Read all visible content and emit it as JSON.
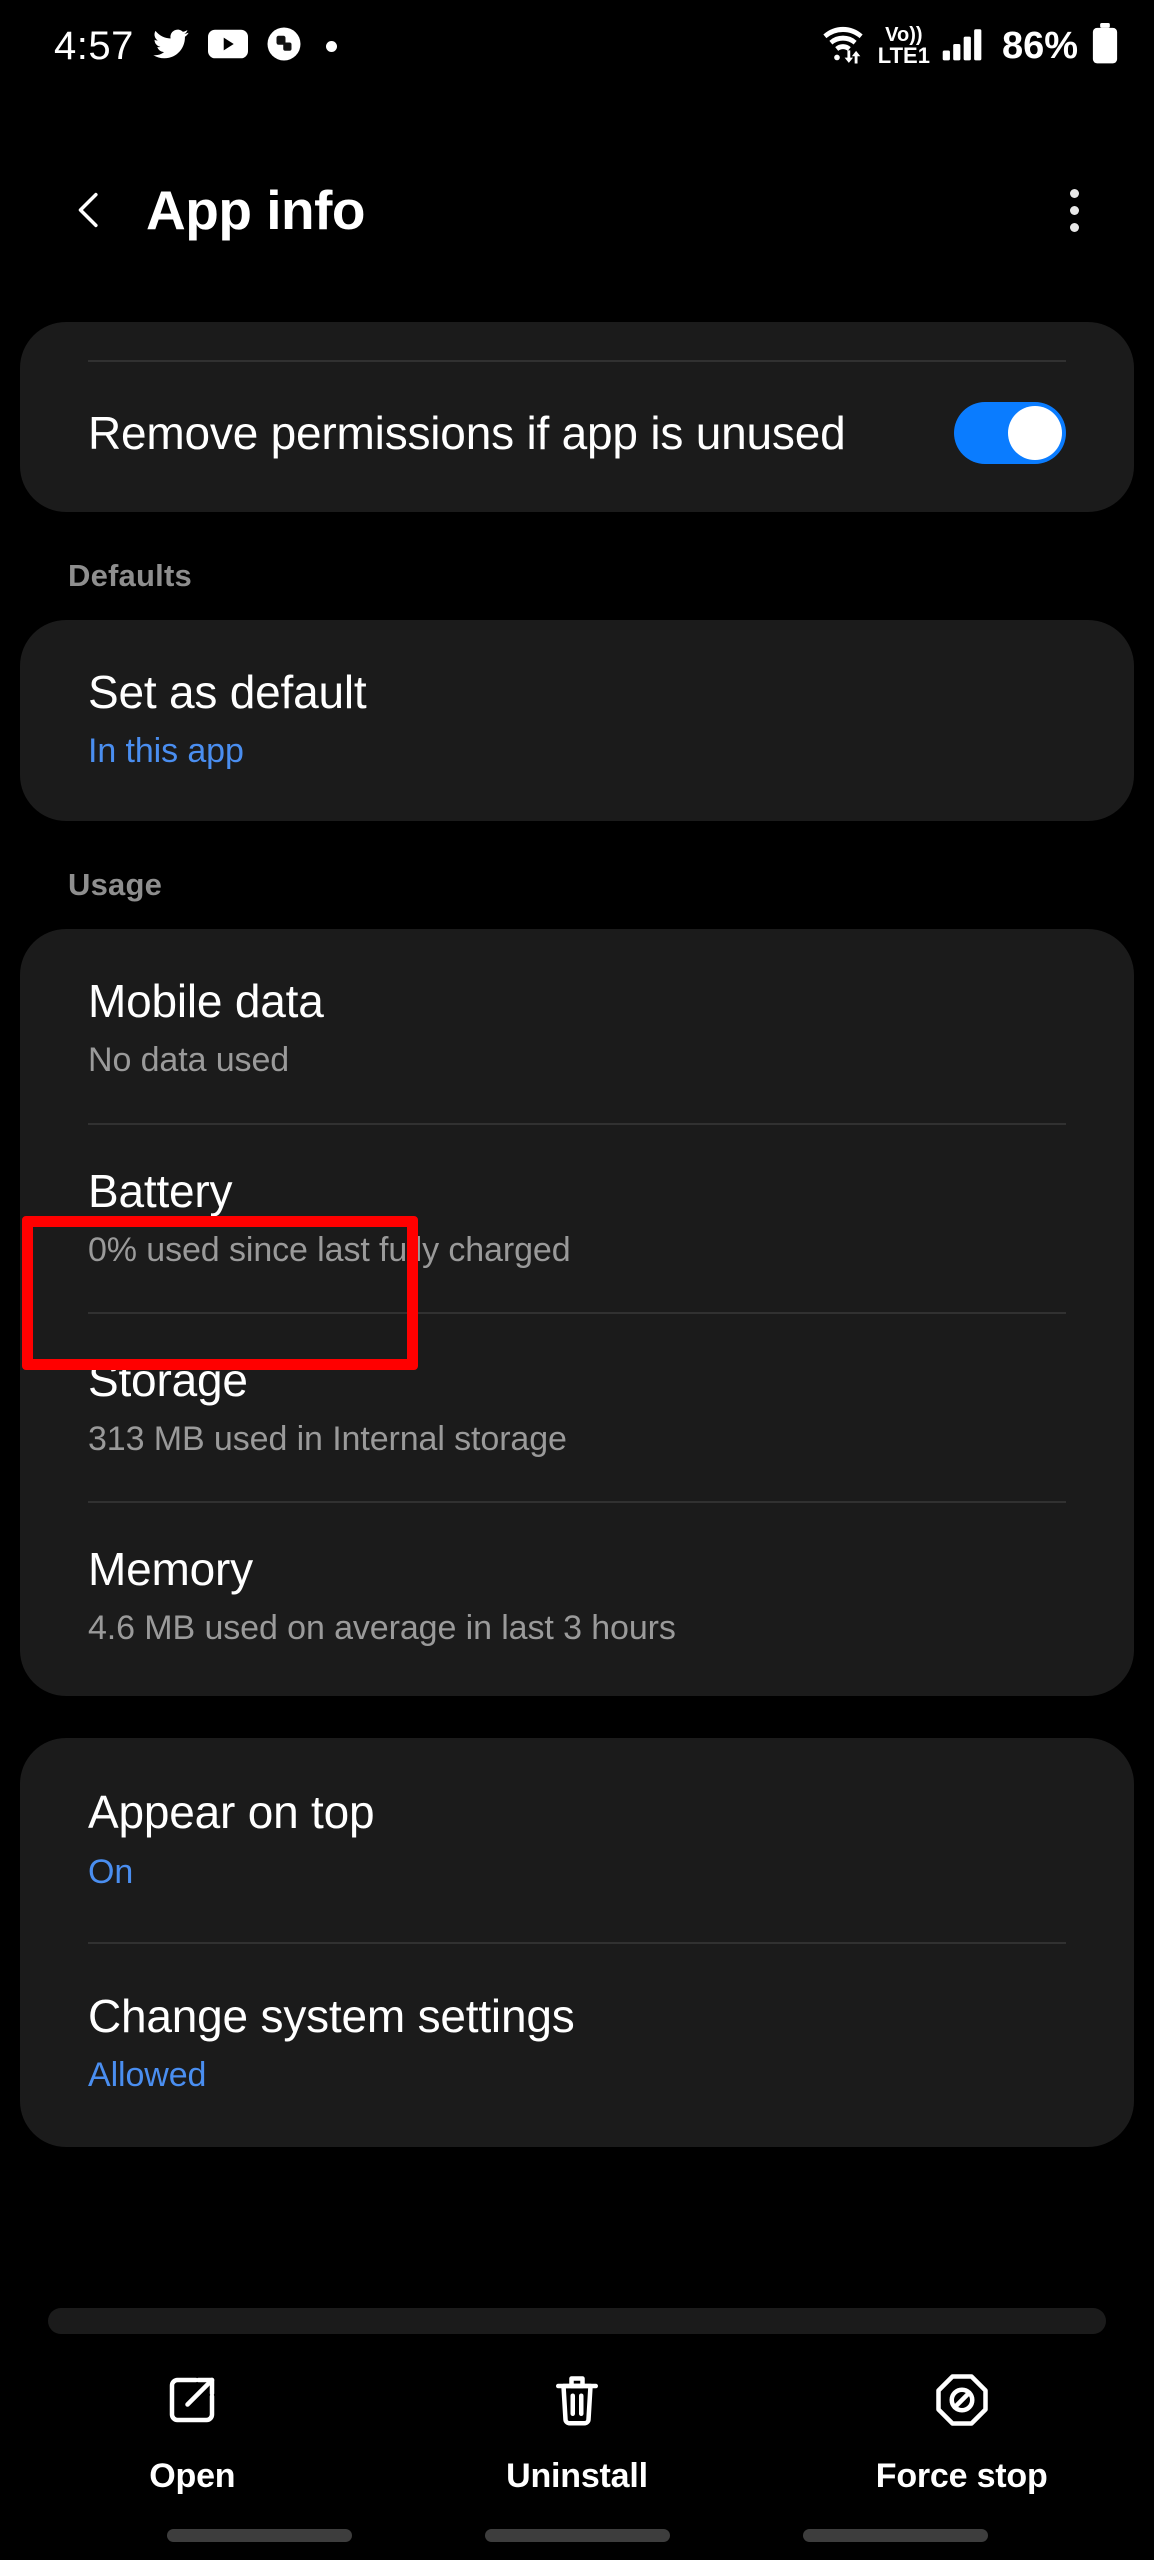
{
  "status_bar": {
    "time": "4:57",
    "notification_icons": [
      "twitter-icon",
      "youtube-icon",
      "app-icon",
      "dot-icon"
    ],
    "wifi_icon": "wifi-icon",
    "volte_label_top": "Vo))",
    "volte_label_bottom": "LTE1",
    "signal_icon": "signal-bars-icon",
    "battery_percent": "86%",
    "battery_icon": "battery-icon"
  },
  "header": {
    "back_icon": "back-chevron-icon",
    "title": "App info",
    "overflow_icon": "more-options-icon"
  },
  "colors": {
    "accent_blue": "#4a8ef0",
    "toggle_on": "#0a7cff",
    "card_bg": "#1b1b1b",
    "highlight_red": "#ff0000",
    "section_label": "#8e8e8e",
    "subtitle_gray": "#9a9a9a"
  },
  "cards": [
    {
      "section_label": null,
      "rows": [
        {
          "title": "Remove permissions if app is unused",
          "subtitle": null,
          "subtitle_style": null,
          "control": "toggle",
          "toggle_on": true,
          "top_divider": true,
          "highlighted": false
        }
      ]
    },
    {
      "section_label": "Defaults",
      "rows": [
        {
          "title": "Set as default",
          "subtitle": "In this app",
          "subtitle_style": "blue",
          "control": null,
          "top_divider": false,
          "highlighted": false
        }
      ]
    },
    {
      "section_label": "Usage",
      "rows": [
        {
          "title": "Mobile data",
          "subtitle": "No data used",
          "subtitle_style": "gray",
          "control": null,
          "top_divider": false,
          "highlighted": false
        },
        {
          "title": "Battery",
          "subtitle": "0% used since last fully charged",
          "subtitle_style": "gray",
          "control": null,
          "top_divider": true,
          "highlighted": true
        },
        {
          "title": "Storage",
          "subtitle": "313 MB used in Internal storage",
          "subtitle_style": "gray",
          "control": null,
          "top_divider": true,
          "highlighted": false
        },
        {
          "title": "Memory",
          "subtitle": "4.6 MB used on average in last 3 hours",
          "subtitle_style": "gray",
          "control": null,
          "top_divider": true,
          "highlighted": false
        }
      ]
    },
    {
      "section_label": null,
      "rows": [
        {
          "title": "Appear on top",
          "subtitle": "On",
          "subtitle_style": "blue",
          "control": null,
          "top_divider": false,
          "highlighted": false
        },
        {
          "title": "Change system settings",
          "subtitle": "Allowed",
          "subtitle_style": "blue",
          "control": null,
          "top_divider": true,
          "highlighted": false
        }
      ]
    }
  ],
  "bottom_bar": {
    "actions": [
      {
        "label": "Open",
        "icon": "open-external-icon"
      },
      {
        "label": "Uninstall",
        "icon": "trash-icon"
      },
      {
        "label": "Force stop",
        "icon": "block-octagon-icon"
      }
    ]
  }
}
